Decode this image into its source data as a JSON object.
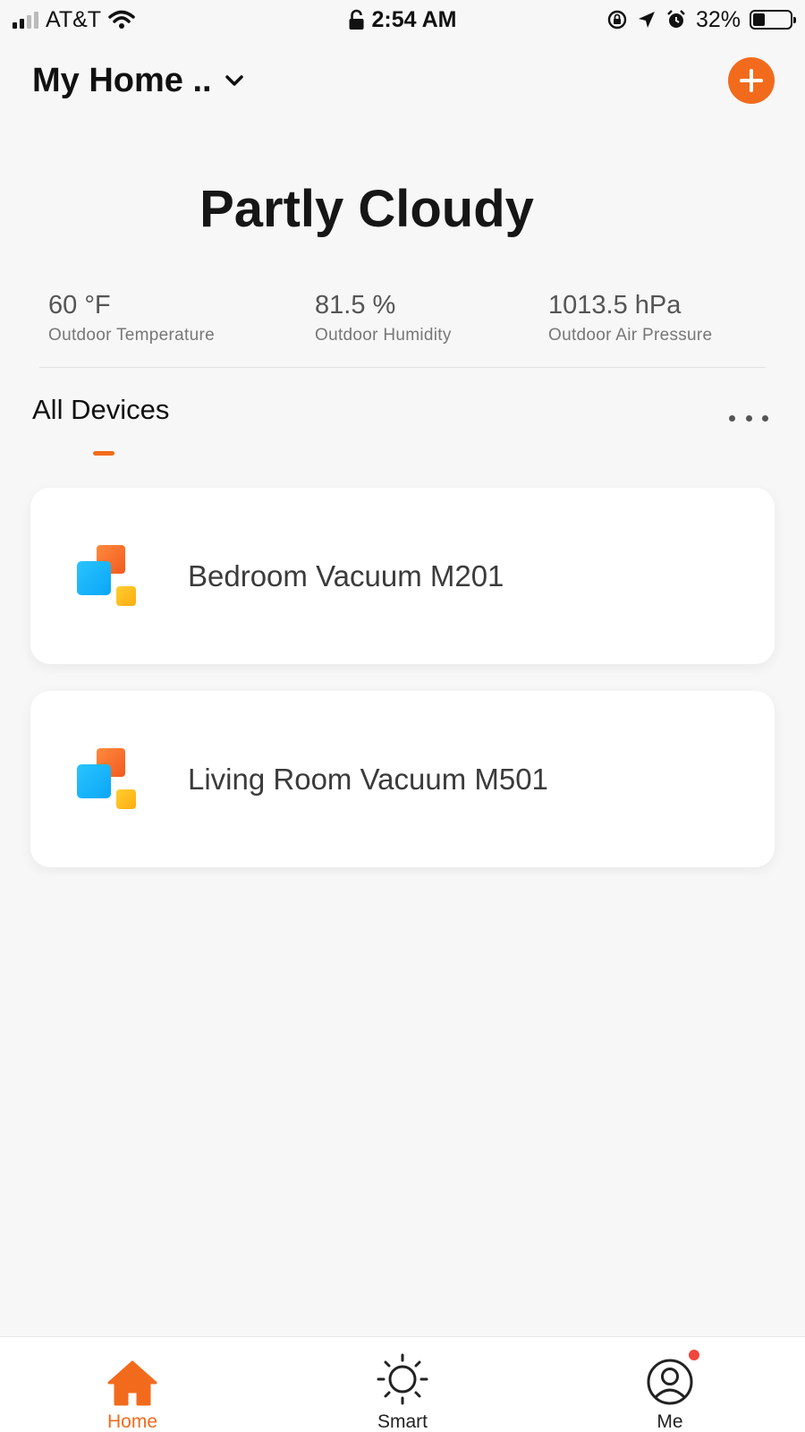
{
  "status_bar": {
    "carrier": "AT&T",
    "time": "2:54 AM",
    "battery_percent": "32%",
    "battery_level": 0.32
  },
  "header": {
    "home_name": "My Home ..",
    "accent_color": "#f26b1d"
  },
  "weather": {
    "condition": "Partly Cloudy",
    "stats": [
      {
        "value": "60 °F",
        "label": "Outdoor Temperature"
      },
      {
        "value": "81.5 %",
        "label": "Outdoor Humidity"
      },
      {
        "value": "1013.5 hPa",
        "label": "Outdoor Air Pressure"
      }
    ]
  },
  "devices": {
    "tab_label": "All Devices",
    "items": [
      {
        "name": "Bedroom Vacuum M201",
        "icon": "vacuum-device-icon"
      },
      {
        "name": "Living Room Vacuum M501",
        "icon": "vacuum-device-icon"
      }
    ]
  },
  "bottom_nav": {
    "items": [
      {
        "label": "Home",
        "icon": "home-icon",
        "active": true
      },
      {
        "label": "Smart",
        "icon": "sun-icon",
        "active": false
      },
      {
        "label": "Me",
        "icon": "profile-icon",
        "active": false,
        "badge": true
      }
    ]
  }
}
